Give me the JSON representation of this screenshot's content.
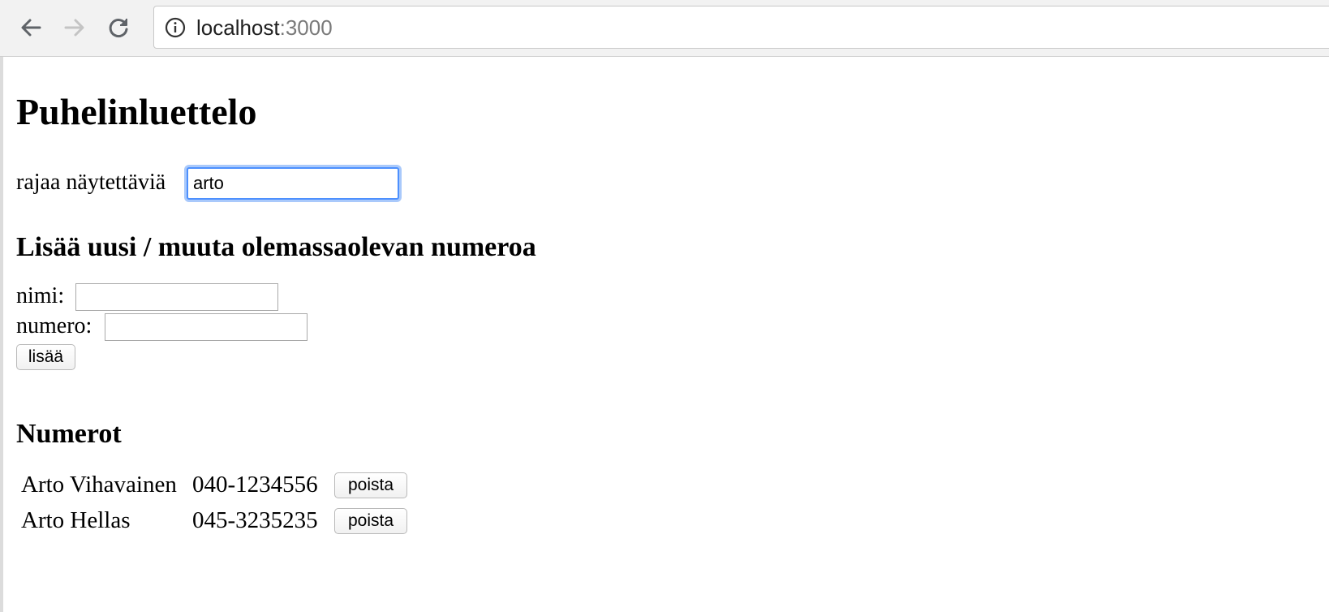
{
  "browser": {
    "url_host": "localhost",
    "url_port": ":3000",
    "icons": {
      "back": "arrow-left-icon",
      "forward": "arrow-right-icon",
      "reload": "reload-icon",
      "info": "info-circle-icon"
    }
  },
  "page": {
    "title": "Puhelinluettelo",
    "filter": {
      "label": "rajaa näytettäviä",
      "value": "arto"
    },
    "form": {
      "heading": "Lisää uusi / muuta olemassaolevan numeroa",
      "name_label": "nimi:",
      "name_value": "",
      "number_label": "numero:",
      "number_value": "",
      "submit_label": "lisää"
    },
    "numbers": {
      "heading": "Numerot",
      "entries": [
        {
          "name": "Arto Vihavainen",
          "number": "040-1234556",
          "delete_label": "poista"
        },
        {
          "name": "Arto Hellas",
          "number": "045-3235235",
          "delete_label": "poista"
        }
      ]
    }
  }
}
